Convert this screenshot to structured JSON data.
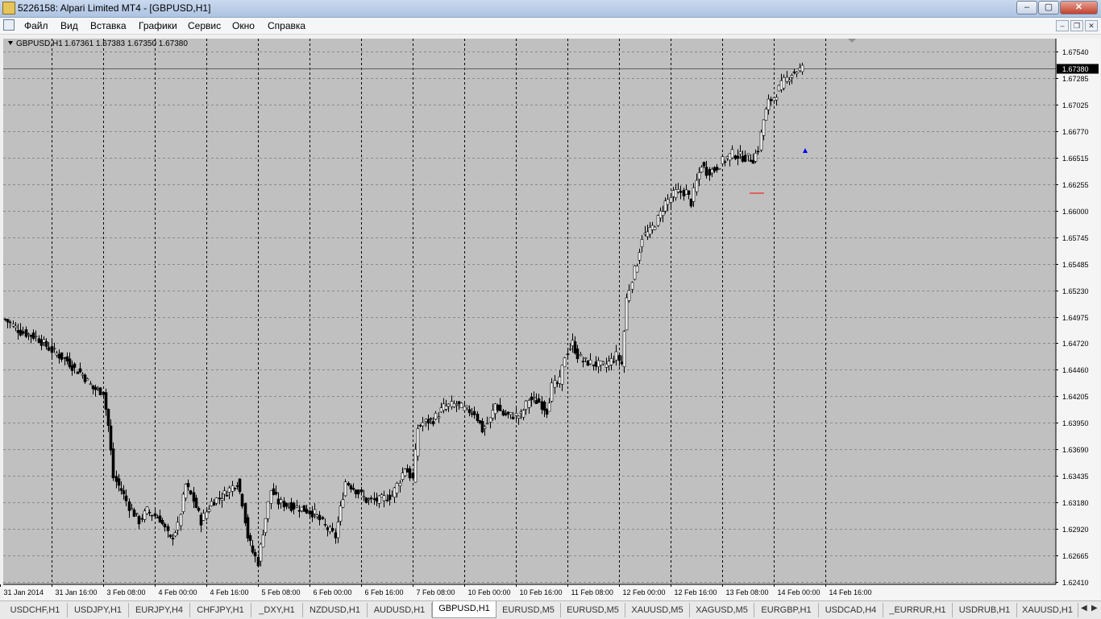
{
  "window": {
    "title": "5226158: Alpari Limited MT4 - [GBPUSD,H1]",
    "controls": {
      "minimize": "‒",
      "maximize": "▢",
      "close": "✕"
    }
  },
  "menu": {
    "items": [
      "Файл",
      "Вид",
      "Вставка",
      "Графики",
      "Сервис",
      "Окно",
      "Справка"
    ],
    "mdi_controls": {
      "minimize": "–",
      "restore": "❐",
      "close": "✕"
    }
  },
  "chart_header": {
    "symbol": "GBPUSD,H1",
    "ohlc": "1.67361 1.67383 1.67350 1.67380"
  },
  "chart_data": {
    "type": "candlestick",
    "symbol": "GBPUSD",
    "timeframe": "H1",
    "ylim": [
      1.6241,
      1.6765
    ],
    "y_ticks": [
      "1.67540",
      "1.67285",
      "1.67025",
      "1.66770",
      "1.66515",
      "1.66255",
      "1.66000",
      "1.65745",
      "1.65485",
      "1.65230",
      "1.64975",
      "1.64720",
      "1.64460",
      "1.64205",
      "1.63950",
      "1.63690",
      "1.63435",
      "1.63180",
      "1.62920",
      "1.62665",
      "1.62410"
    ],
    "x_ticks": [
      "31 Jan 2014",
      "31 Jan 16:00",
      "3 Feb 08:00",
      "4 Feb 00:00",
      "4 Feb 16:00",
      "5 Feb 08:00",
      "6 Feb 00:00",
      "6 Feb 16:00",
      "7 Feb 08:00",
      "10 Feb 00:00",
      "10 Feb 16:00",
      "11 Feb 08:00",
      "12 Feb 00:00",
      "12 Feb 16:00",
      "13 Feb 08:00",
      "14 Feb 00:00",
      "14 Feb 16:00"
    ],
    "current_price": "1.67380",
    "grid": true,
    "close_path": [
      [
        0,
        1.6495
      ],
      [
        6,
        1.6483
      ],
      [
        12,
        1.6478
      ],
      [
        18,
        1.6465
      ],
      [
        24,
        1.6455
      ],
      [
        27,
        1.6447
      ],
      [
        30,
        1.6442
      ],
      [
        34,
        1.6428
      ],
      [
        38,
        1.6425
      ],
      [
        40,
        1.6392
      ],
      [
        42,
        1.6342
      ],
      [
        45,
        1.633
      ],
      [
        48,
        1.6314
      ],
      [
        52,
        1.63
      ],
      [
        55,
        1.631
      ],
      [
        60,
        1.6302
      ],
      [
        64,
        1.6282
      ],
      [
        67,
        1.6295
      ],
      [
        70,
        1.6335
      ],
      [
        73,
        1.632
      ],
      [
        76,
        1.63
      ],
      [
        80,
        1.6318
      ],
      [
        85,
        1.6326
      ],
      [
        90,
        1.6338
      ],
      [
        92,
        1.6318
      ],
      [
        94,
        1.6285
      ],
      [
        96,
        1.627
      ],
      [
        98,
        1.626
      ],
      [
        100,
        1.629
      ],
      [
        103,
        1.633
      ],
      [
        106,
        1.6318
      ],
      [
        110,
        1.6315
      ],
      [
        115,
        1.6312
      ],
      [
        120,
        1.6307
      ],
      [
        124,
        1.6295
      ],
      [
        128,
        1.6285
      ],
      [
        132,
        1.6338
      ],
      [
        136,
        1.633
      ],
      [
        140,
        1.632
      ],
      [
        145,
        1.632
      ],
      [
        150,
        1.6325
      ],
      [
        153,
        1.634
      ],
      [
        155,
        1.6352
      ],
      [
        158,
        1.634
      ],
      [
        160,
        1.639
      ],
      [
        162,
        1.6395
      ],
      [
        166,
        1.6398
      ],
      [
        170,
        1.641
      ],
      [
        175,
        1.6413
      ],
      [
        178,
        1.6408
      ],
      [
        182,
        1.6405
      ],
      [
        185,
        1.6388
      ],
      [
        188,
        1.6398
      ],
      [
        190,
        1.6413
      ],
      [
        193,
        1.6403
      ],
      [
        196,
        1.6402
      ],
      [
        200,
        1.6402
      ],
      [
        203,
        1.6418
      ],
      [
        207,
        1.6415
      ],
      [
        210,
        1.6407
      ],
      [
        212,
        1.643
      ],
      [
        215,
        1.6435
      ],
      [
        217,
        1.646
      ],
      [
        220,
        1.6472
      ],
      [
        222,
        1.646
      ],
      [
        224,
        1.6455
      ],
      [
        228,
        1.6452
      ],
      [
        232,
        1.645
      ],
      [
        235,
        1.6455
      ],
      [
        237,
        1.646
      ],
      [
        239,
        1.6452
      ],
      [
        241,
        1.6515
      ],
      [
        243,
        1.6535
      ],
      [
        245,
        1.655
      ],
      [
        247,
        1.6575
      ],
      [
        250,
        1.658
      ],
      [
        253,
        1.6592
      ],
      [
        256,
        1.6608
      ],
      [
        260,
        1.6618
      ],
      [
        264,
        1.6618
      ],
      [
        266,
        1.6608
      ],
      [
        268,
        1.6628
      ],
      [
        270,
        1.6645
      ],
      [
        272,
        1.6638
      ],
      [
        275,
        1.664
      ],
      [
        278,
        1.6648
      ],
      [
        282,
        1.6655
      ],
      [
        286,
        1.6652
      ],
      [
        290,
        1.665
      ],
      [
        292,
        1.666
      ],
      [
        294,
        1.6688
      ],
      [
        296,
        1.6705
      ],
      [
        298,
        1.671
      ],
      [
        300,
        1.6718
      ],
      [
        302,
        1.6725
      ],
      [
        305,
        1.6733
      ],
      [
        309,
        1.6738
      ]
    ]
  },
  "tabs": [
    {
      "label": "USDCHF,H1"
    },
    {
      "label": "USDJPY,H1"
    },
    {
      "label": "EURJPY,H4"
    },
    {
      "label": "CHFJPY,H1"
    },
    {
      "label": "_DXY,H1"
    },
    {
      "label": "NZDUSD,H1"
    },
    {
      "label": "AUDUSD,H1"
    },
    {
      "label": "GBPUSD,H1"
    },
    {
      "label": "EURUSD,M5"
    },
    {
      "label": "EURUSD,M5"
    },
    {
      "label": "XAUUSD,M5"
    },
    {
      "label": "XAGUSD,M5"
    },
    {
      "label": "EURGBP,H1"
    },
    {
      "label": "USDCAD,H4"
    },
    {
      "label": "_EURRUR,H1"
    },
    {
      "label": "USDRUB,H1"
    },
    {
      "label": "XAUUSD,H1"
    }
  ],
  "active_tab": "GBPUSD,H1",
  "colors": {
    "chart_bg": "#c0c0c0",
    "candle": "#000000",
    "grid": "#7a7a7a",
    "accent_marker": "#0000ff",
    "level_line": "#ff0000"
  }
}
